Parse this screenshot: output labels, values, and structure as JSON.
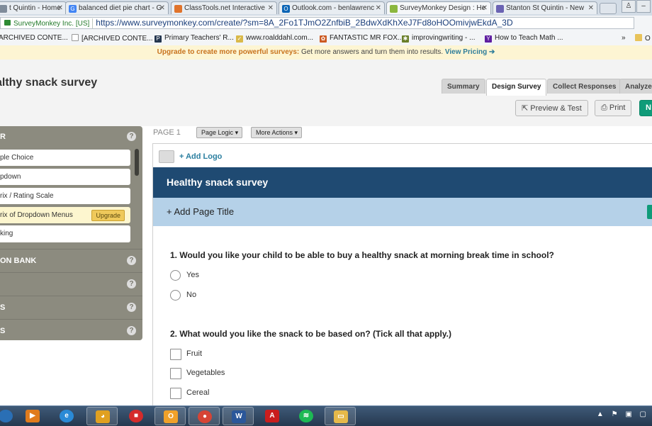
{
  "browser": {
    "tabs": [
      {
        "title": "t Quintin - Home",
        "icon": "page-icon",
        "favicon_color": "#7f8c9a",
        "active": false
      },
      {
        "title": "balanced diet pie chart - G",
        "icon": "google-icon",
        "favicon_color": "#4285f4",
        "active": false
      },
      {
        "title": "ClassTools.net Interactive",
        "icon": "classtools-icon",
        "favicon_color": "#e0732b",
        "active": false
      },
      {
        "title": "Outlook.com - benlawrenc",
        "icon": "outlook-icon",
        "favicon_color": "#0a64b5",
        "active": false
      },
      {
        "title": "SurveyMonkey Design : He",
        "icon": "surveymonkey-icon",
        "favicon_color": "#8bb73e",
        "active": true
      },
      {
        "title": "Stanton St Quintin - New",
        "icon": "site-icon",
        "favicon_color": "#6a63b3",
        "active": false
      }
    ],
    "address": {
      "ev_cert": "SurveyMonkey Inc. [US]",
      "url": "https://www.surveymonkey.com/create/?sm=8A_2Fo1TJmO2ZnfbiB_2BdwXdKhXeJ7Fd8oHOOmivjwEkdA_3D"
    },
    "bookmarks": [
      {
        "label": "ARCHIVED CONTE...",
        "icon": "folder-icon"
      },
      {
        "label": "[ARCHIVED CONTE...",
        "icon": "page-icon"
      },
      {
        "label": "Primary Teachers' R...",
        "icon": "teachers-icon"
      },
      {
        "label": "www.roalddahl.com...",
        "icon": "roalddahl-icon"
      },
      {
        "label": "FANTASTIC MR FOX...",
        "icon": "fox-icon"
      },
      {
        "label": "improvingwriting - ...",
        "icon": "improvingwriting-icon"
      },
      {
        "label": "How to Teach Math ...",
        "icon": "yahoo-icon"
      }
    ],
    "bookmarks_more": "»",
    "bookmarks_other": "O"
  },
  "upgrade_banner": {
    "lead": "Upgrade to create more powerful surveys:",
    "body": "Get more answers and turn them into results.",
    "link": "View Pricing ➔"
  },
  "header": {
    "survey_title": "althy snack survey",
    "tabs": [
      {
        "label": "Summary",
        "active": false
      },
      {
        "label": "Design Survey",
        "active": true
      },
      {
        "label": "Collect Responses",
        "active": false
      },
      {
        "label": "Analyze",
        "active": false
      }
    ]
  },
  "toolbar": {
    "preview_label": "Preview & Test",
    "print_label": "Print",
    "next_label": "N"
  },
  "builder": {
    "section_header": "R",
    "question_types": [
      {
        "label": "ple Choice",
        "upgrade": false
      },
      {
        "label": "pdown",
        "upgrade": false
      },
      {
        "label": "rix / Rating Scale",
        "upgrade": false
      },
      {
        "label": "rix of Dropdown Menus",
        "upgrade": true
      },
      {
        "label": "king",
        "upgrade": false
      }
    ],
    "upgrade_badge": "Upgrade",
    "sections": [
      "ON BANK",
      "",
      "S",
      "S"
    ],
    "help_glyph": "?"
  },
  "page": {
    "label": "PAGE 1",
    "page_logic": "Page Logic",
    "more_actions": "More Actions",
    "add_logo": "+ Add Logo",
    "survey_title": "Healthy snack survey",
    "add_page_title": "+ Add Page Title"
  },
  "questions": [
    {
      "text": "1. Would you like your child to be able to buy a healthy snack at morning break time in school?",
      "kind": "radio",
      "options": [
        "Yes",
        "No"
      ]
    },
    {
      "text": "2. What would you like the snack to be based on? (Tick all that apply.)",
      "kind": "checkbox",
      "options": [
        "Fruit",
        "Vegetables",
        "Cereal"
      ]
    }
  ],
  "taskbar": {
    "items": [
      {
        "icon": "start-orb-icon",
        "glyph": "",
        "color": "#2a6fb5"
      },
      {
        "icon": "media-player-icon",
        "glyph": "▶",
        "color": "#e07b1c"
      },
      {
        "icon": "internet-explorer-icon",
        "glyph": "e",
        "color": "#2a8ad6"
      },
      {
        "icon": "scratch-cat-icon",
        "glyph": "◕",
        "color": "#e0a020"
      },
      {
        "icon": "red-book-icon",
        "glyph": "■",
        "color": "#d52b2b"
      },
      {
        "icon": "outlook-icon",
        "glyph": "O",
        "color": "#f0a12a"
      },
      {
        "icon": "chrome-icon",
        "glyph": "●",
        "color": "#d64435"
      },
      {
        "icon": "word-icon",
        "glyph": "W",
        "color": "#2b579a"
      },
      {
        "icon": "acrobat-icon",
        "glyph": "A",
        "color": "#c91d1d"
      },
      {
        "icon": "spotify-icon",
        "glyph": "≋",
        "color": "#1db954"
      },
      {
        "icon": "file-explorer-icon",
        "glyph": "▭",
        "color": "#e6b94a"
      }
    ],
    "tray": [
      "▲",
      "⚑",
      "▣",
      "▢"
    ]
  }
}
